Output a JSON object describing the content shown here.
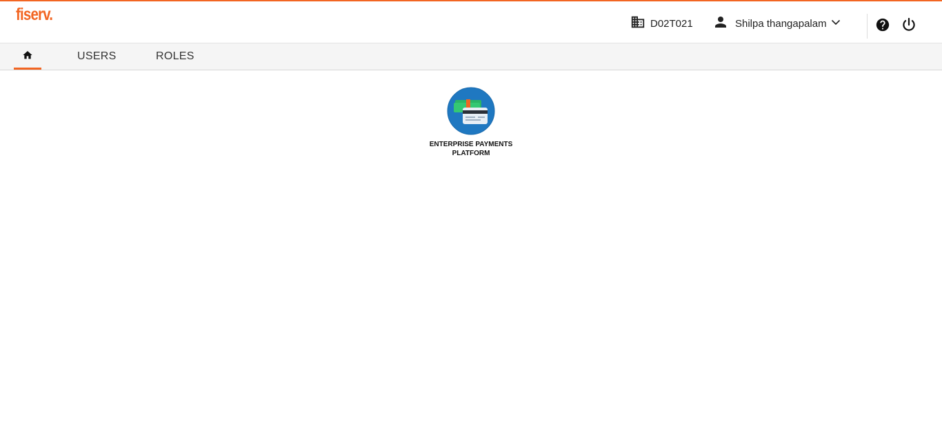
{
  "brand": {
    "logo_text": "fiserv",
    "logo_dot": ".",
    "accent_color": "#f26522"
  },
  "header": {
    "org_icon": "building-icon",
    "org_code": "D02T021",
    "user_icon": "person-icon",
    "user_name": "Shilpa thangapalam",
    "user_menu_icon": "chevron-down-icon",
    "help_icon": "help-icon",
    "logout_icon": "power-icon"
  },
  "nav": {
    "home_icon": "home-icon",
    "tabs": [
      {
        "label": "USERS"
      },
      {
        "label": "ROLES"
      }
    ],
    "active": "home"
  },
  "tiles": [
    {
      "label_line1": "ENTERPRISE PAYMENTS",
      "label_line2": "PLATFORM",
      "icon": "payments-card-icon",
      "icon_color": "#1f78c1"
    }
  ]
}
